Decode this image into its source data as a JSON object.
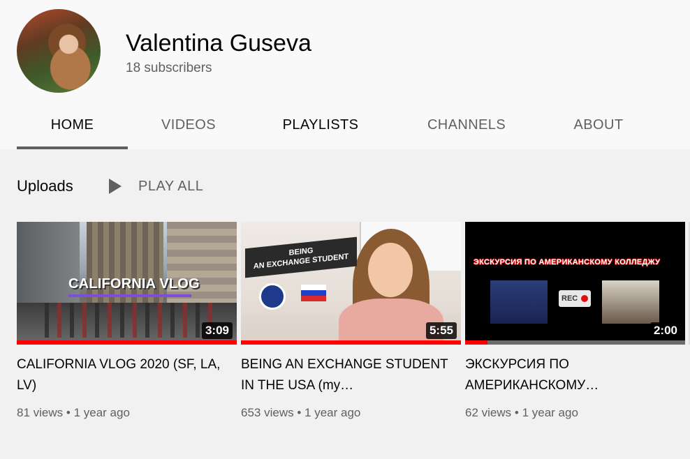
{
  "channel": {
    "name": "Valentina Guseva",
    "subscribers": "18 subscribers"
  },
  "tabs": [
    {
      "label": "HOME",
      "active": true
    },
    {
      "label": "VIDEOS",
      "active": false
    },
    {
      "label": "PLAYLISTS",
      "active": false
    },
    {
      "label": "CHANNELS",
      "active": false
    },
    {
      "label": "ABOUT",
      "active": false
    }
  ],
  "uploads": {
    "title": "Uploads",
    "play_all": "PLAY ALL",
    "videos": [
      {
        "title": "CALIFORNIA VLOG 2020 (SF, LA, LV)",
        "duration": "3:09",
        "views": "81 views",
        "age": "1 year ago",
        "thumb_text": "CALIFORNIA VLOG",
        "watched_fraction": 1.0
      },
      {
        "title": "BEING AN EXCHANGE STUDENT IN THE USA (my…",
        "duration": "5:55",
        "views": "653 views",
        "age": "1 year ago",
        "thumb_text": "BEING\nAN EXCHANGE STUDENT",
        "watched_fraction": 1.0
      },
      {
        "title": "ЭКСКУРСИЯ ПО АМЕРИКАНСКОМУ…",
        "duration": "2:00",
        "views": "62 views",
        "age": "1 year ago",
        "thumb_text": "ЭКСКУРСИЯ ПО АМЕРИКАНСКОМУ КОЛЛЕДЖУ",
        "thumb_badge": "REC",
        "watched_fraction": 0.1
      }
    ]
  },
  "colors": {
    "progress_red": "#ff0000",
    "text_primary": "#030303",
    "text_secondary": "#606060"
  }
}
